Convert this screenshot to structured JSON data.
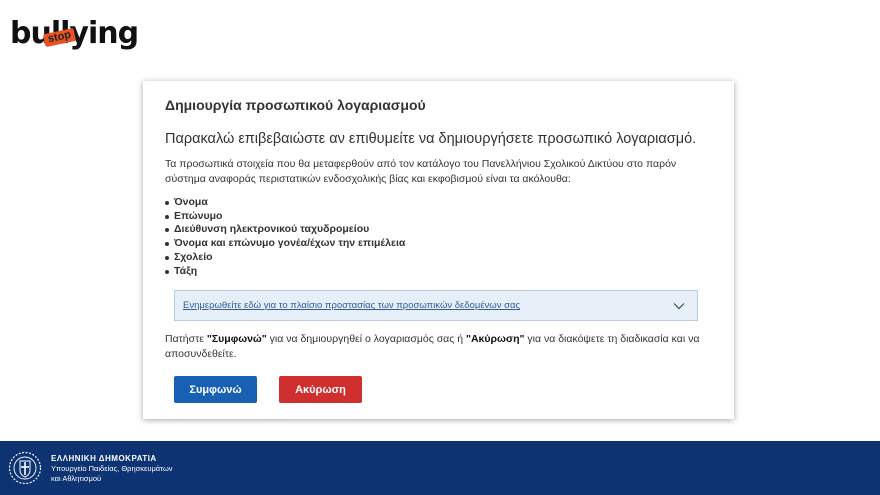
{
  "logo": {
    "text": "bullying",
    "stamp": "stop"
  },
  "card": {
    "title": "Δημιουργία προσωπικού λογαριασμού",
    "subtitle": "Παρακαλώ επιβεβαιώστε αν επιθυμείτε να δημιουργήσετε προσωπικό λογαριασμό.",
    "intro": "Τα προσωπικά στοιχεία που θα μεταφερθούν από τον κατάλογο του Πανελλήνιου Σχολικού Δικτύου στο παρόν σύστημα αναφοράς περιστατικών ενδοσχολικής βίας και εκφοβισμού είναι τα ακόλουθα:",
    "fields": [
      "Όνομα",
      "Επώνυμο",
      "Διεύθυνση ηλεκτρονικού ταχυδρομείου",
      "Όνομα και επώνυμο γονέα/έχων την επιμέλεια",
      "Σχολείο",
      "Τάξη"
    ],
    "accordion_label": "Ενημερωθείτε εδώ για το πλαίσιο προστασίας των προσωπικών δεδομένων σας",
    "notice": {
      "part1": "Πατήστε ",
      "agree_ref": "\"Συμφωνώ\"",
      "part2": " για να δημιουργηθεί ο λογαριασμός σας ή ",
      "cancel_ref": "\"Ακύρωση\"",
      "part3": " για να διακόψετε τη διαδικασία και να αποσυνδεθείτε."
    },
    "agree_label": "Συμφωνώ",
    "cancel_label": "Ακύρωση"
  },
  "footer": {
    "government": "ΕΛΛΗΝΙΚΗ ΔΗΜΟΚΡΑΤΙΑ",
    "ministry_line1": "Υπουργείο Παιδείας, Θρησκευμάτων",
    "ministry_line2": "και Αθλητισμού"
  },
  "colors": {
    "primary": "#1760b4",
    "danger": "#cf2f2f",
    "footer_bg": "#0d3372",
    "accordion_bg": "#e6eef8",
    "logo_accent": "#e8531f"
  },
  "icons": [
    "chevron-down-icon",
    "greek-emblem-icon"
  ]
}
